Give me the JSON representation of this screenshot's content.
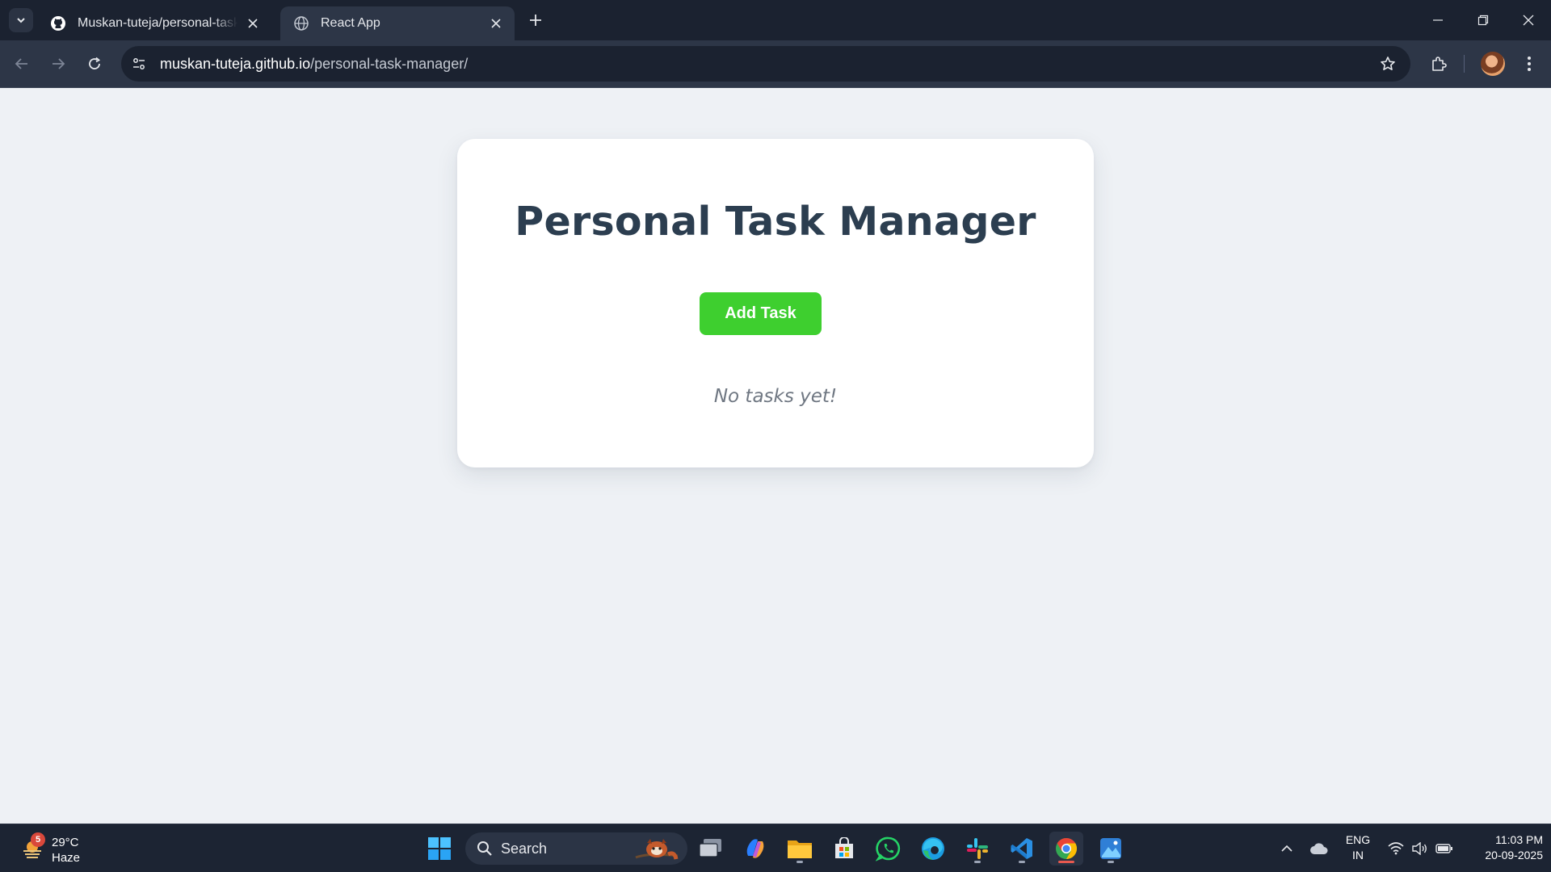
{
  "browser": {
    "tabs": [
      {
        "title": "Muskan-tuteja/personal-task-manager",
        "favicon": "github-icon",
        "active": false
      },
      {
        "title": "React App",
        "favicon": "globe-icon",
        "active": true
      }
    ],
    "url_host": "muskan-tuteja.github.io",
    "url_path": "/personal-task-manager/"
  },
  "app": {
    "title": "Personal Task Manager",
    "add_button_label": "Add Task",
    "empty_message": "No tasks yet!",
    "colors": {
      "title": "#2c3e50",
      "add_button": "#3ecf2f",
      "background": "#eef1f5",
      "card": "#ffffff"
    }
  },
  "taskbar": {
    "weather": {
      "badge": "5",
      "temp": "29°C",
      "condition": "Haze"
    },
    "search_label": "Search",
    "pinned_apps": [
      "start-icon",
      "task-view-icon",
      "copilot-icon",
      "file-explorer-icon",
      "microsoft-store-icon",
      "whatsapp-icon",
      "edge-icon",
      "slack-icon",
      "vscode-icon",
      "chrome-icon",
      "photos-icon"
    ],
    "language": {
      "line1": "ENG",
      "line2": "IN"
    },
    "clock": {
      "time": "11:03 PM",
      "date": "20-09-2025"
    }
  }
}
